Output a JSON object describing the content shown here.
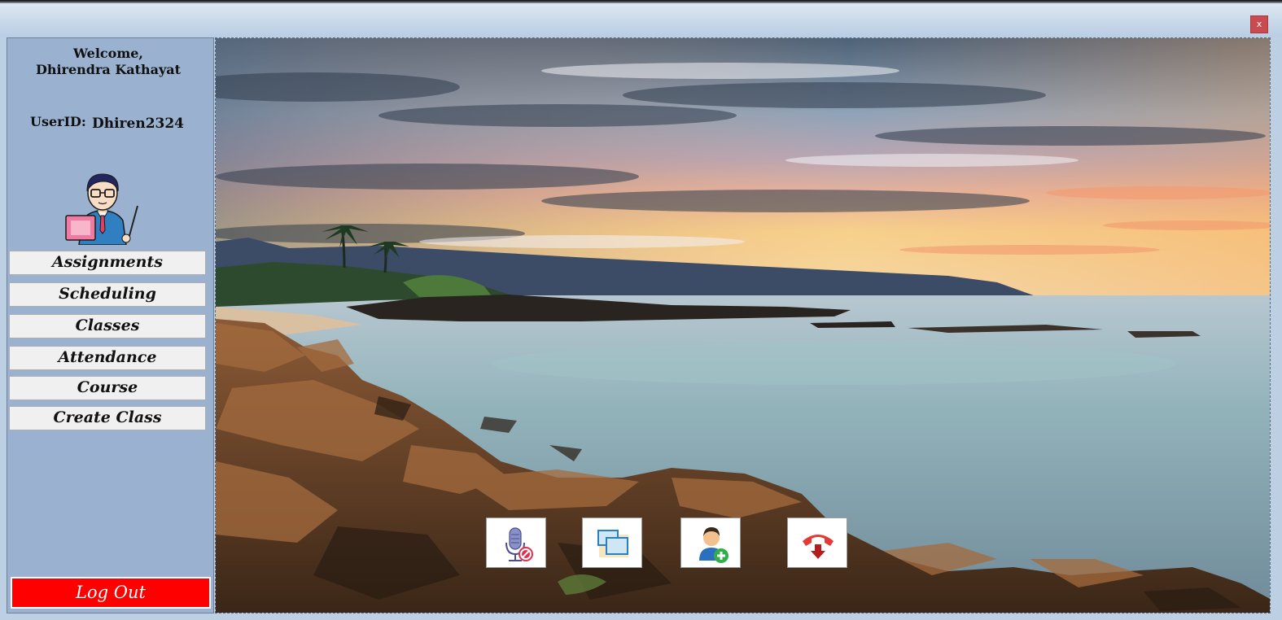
{
  "window": {
    "close_label": "x"
  },
  "sidebar": {
    "welcome_line1": "Welcome,",
    "welcome_name": "Dhirendra Kathayat",
    "userid_label": "UserID:",
    "userid_value": "Dhiren2324",
    "nav": [
      {
        "label": "Assignments"
      },
      {
        "label": "Scheduling"
      },
      {
        "label": "Classes"
      },
      {
        "label": "Attendance"
      },
      {
        "label": "Course"
      },
      {
        "label": "Create Class"
      }
    ],
    "logout_label": "Log Out"
  },
  "call_controls": [
    {
      "icon": "mute-microphone-icon"
    },
    {
      "icon": "share-screen-icon"
    },
    {
      "icon": "add-participant-icon"
    },
    {
      "icon": "end-call-icon"
    }
  ],
  "colors": {
    "sidebar_bg": "#9ab2cf",
    "logout_bg": "#ff0000",
    "close_bg": "#c94a4f"
  }
}
